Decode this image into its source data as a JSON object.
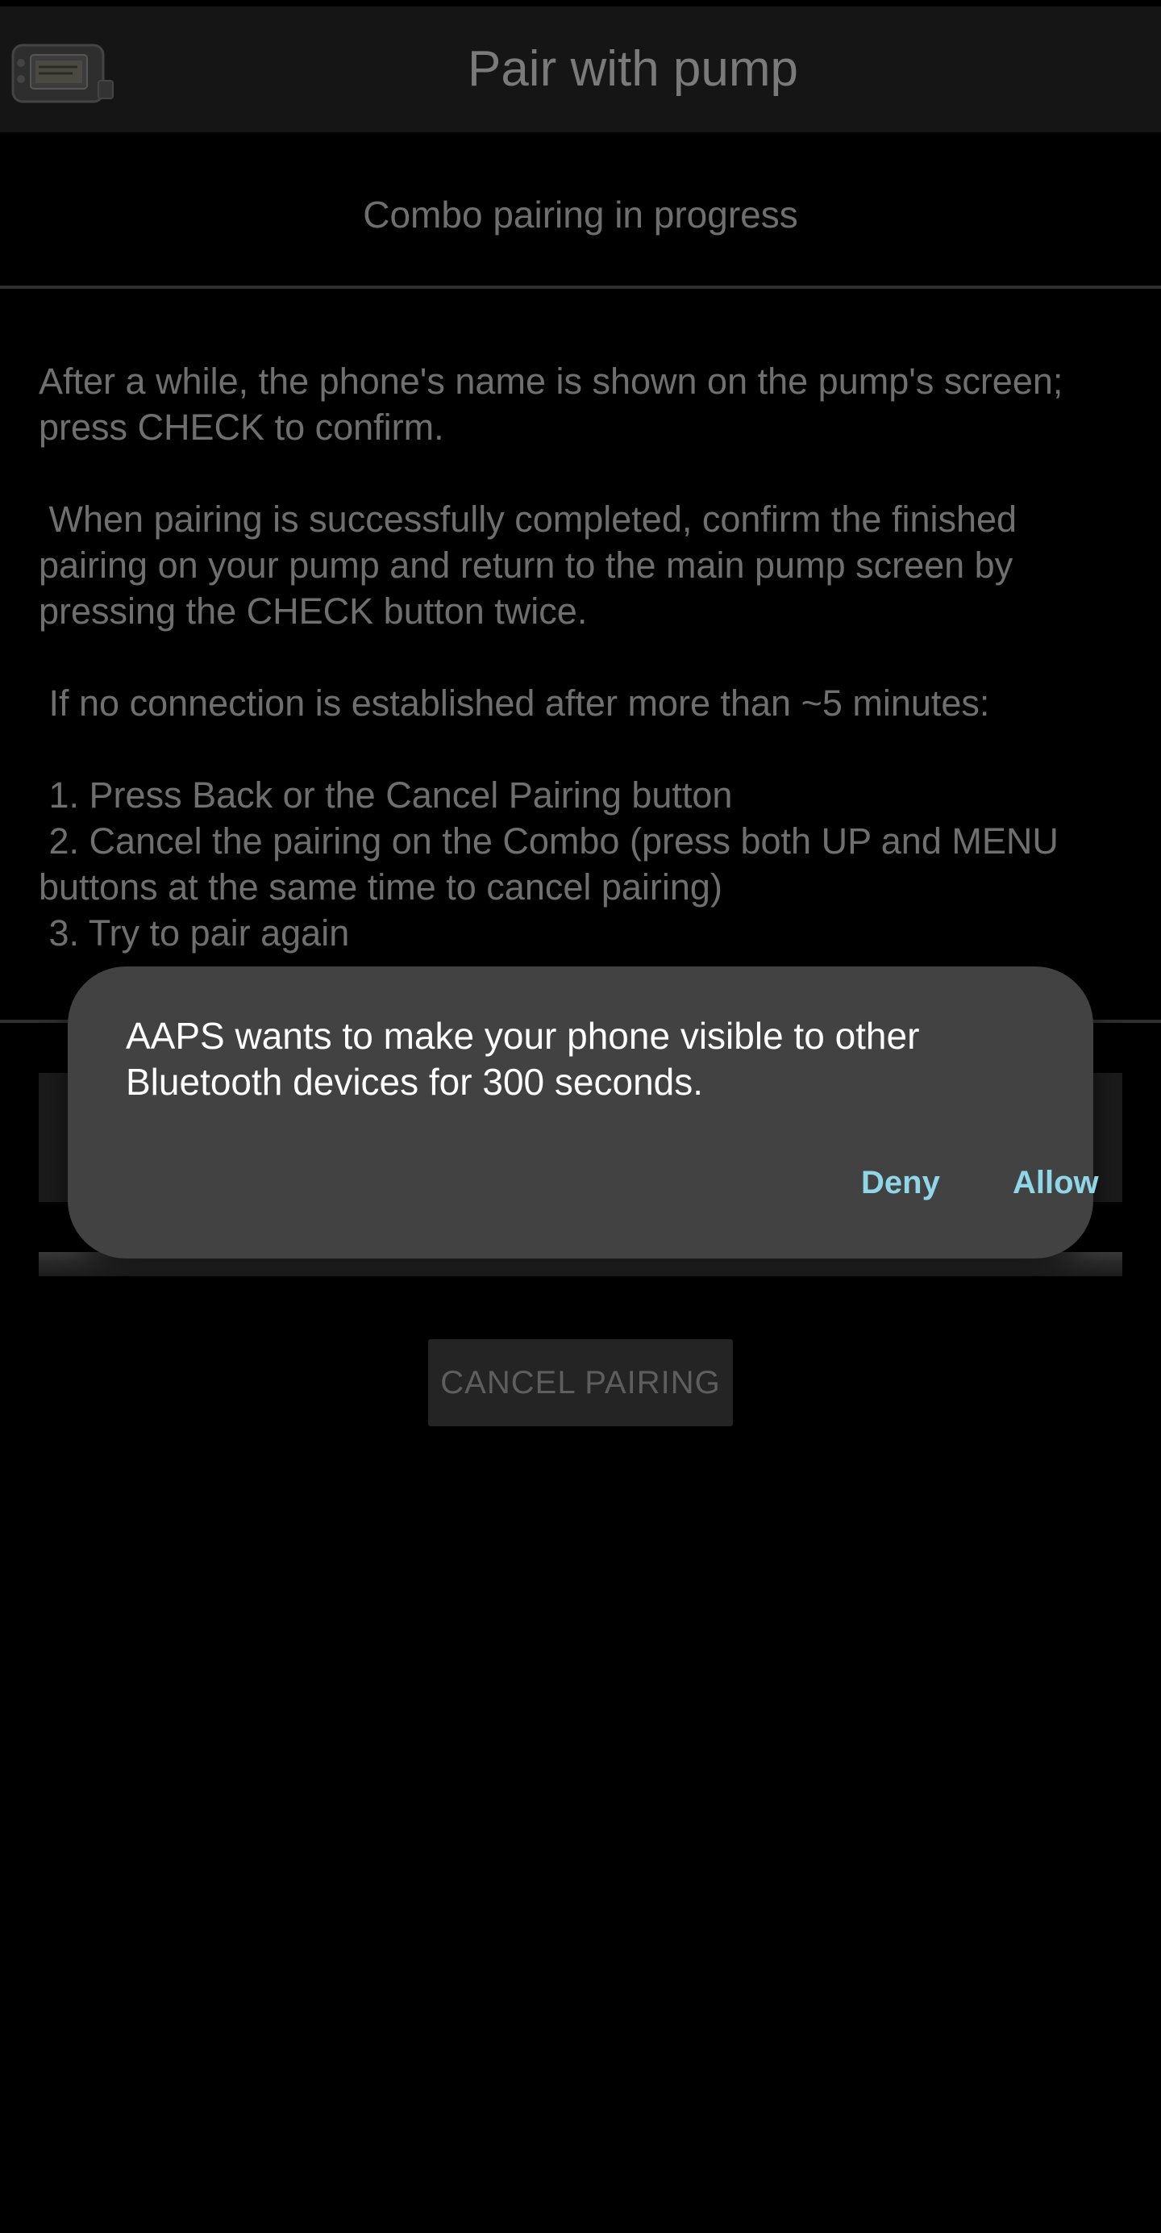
{
  "appbar": {
    "title": "Pair with pump",
    "icon": "pump-icon"
  },
  "pairing": {
    "status_title": "Combo pairing in progress",
    "instructions": {
      "step_intro": "After a while, the phone's name is shown on the pump's screen; press CHECK to confirm.",
      "completion": " When pairing is successfully completed, confirm the finished pairing on your pump and return to the main pump screen by pressing the CHECK button twice.",
      "timeout_intro": " If no connection is established after more than ~5 minutes:",
      "steps": [
        " 1. Press Back or the Cancel Pairing button",
        " 2. Cancel the pairing on the Combo (press both UP and MENU buttons at the same time to cancel pairing)",
        " 3. Try to pair again"
      ]
    },
    "cancel_label": "CANCEL PAIRING"
  },
  "dialog": {
    "message": "AAPS wants to make your phone visible to other Bluetooth devices for 300 seconds.",
    "deny_label": "Deny",
    "allow_label": "Allow"
  },
  "colors": {
    "background": "#000000",
    "appbar": "#151515",
    "dialog": "#424242",
    "dialog_accent": "#8fd7e8",
    "dimmed_text": "#6f6f6f"
  }
}
